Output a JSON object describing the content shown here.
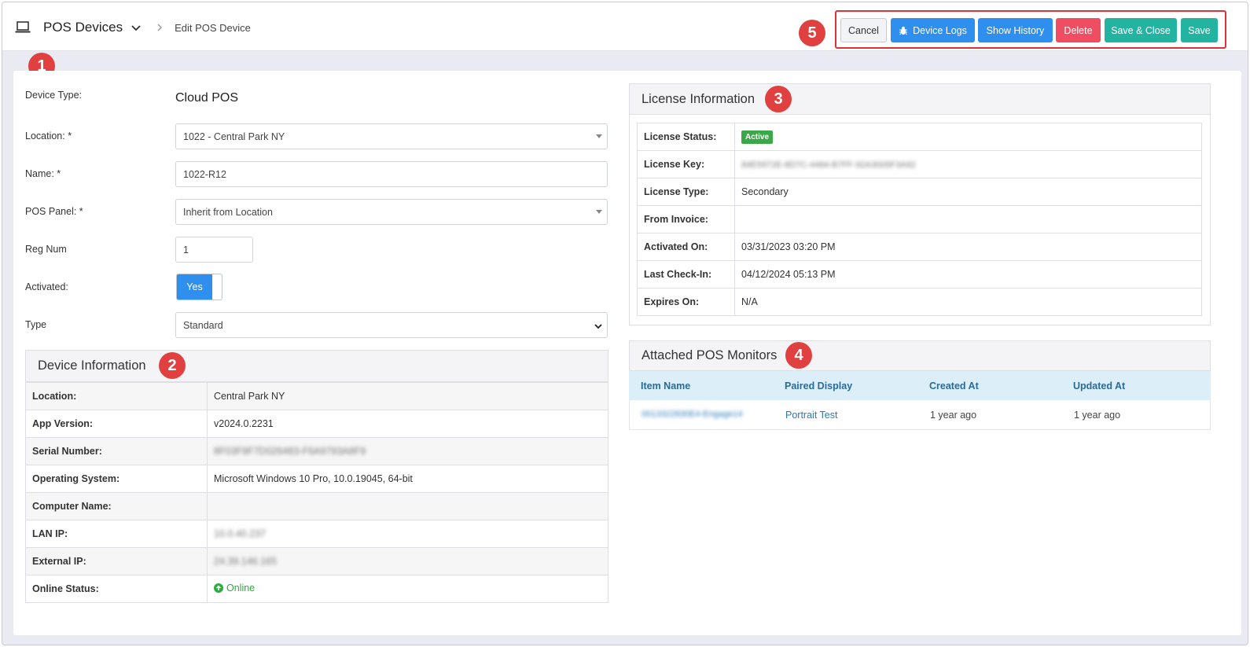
{
  "breadcrumb": {
    "module": "POS Devices",
    "current": "Edit POS Device",
    "icons": {
      "device": "laptop-icon",
      "dropdown": "chevron-down-icon",
      "separator": "chevron-right-icon"
    }
  },
  "toolbar": {
    "cancel": "Cancel",
    "device_logs": "Device Logs",
    "device_logs_icon": "bug-icon",
    "show_history": "Show History",
    "delete": "Delete",
    "save_close": "Save & Close",
    "save": "Save"
  },
  "callouts": [
    "1",
    "2",
    "3",
    "4",
    "5"
  ],
  "form": {
    "device_type": {
      "label": "Device Type:",
      "value": "Cloud POS"
    },
    "location": {
      "label": "Location: *",
      "value": "1022 - Central Park NY"
    },
    "name": {
      "label": "Name: *",
      "value": "1022-R12"
    },
    "pos_panel": {
      "label": "POS Panel: *",
      "value": "Inherit from Location"
    },
    "reg_num": {
      "label": "Reg Num",
      "value": "1"
    },
    "activated": {
      "label": "Activated:",
      "value": "Yes",
      "on": true
    },
    "type": {
      "label": "Type",
      "value": "Standard"
    }
  },
  "device_info": {
    "title": "Device Information",
    "rows": [
      {
        "key": "Location:",
        "value": "Central Park NY",
        "blurred": false
      },
      {
        "key": "App Version:",
        "value": "v2024.0.2231",
        "blurred": false
      },
      {
        "key": "Serial Number:",
        "value": "8F03F9F7D026483-F6A9793A8F9",
        "blurred": true
      },
      {
        "key": "Operating System:",
        "value": "Microsoft Windows 10 Pro, 10.0.19045, 64-bit",
        "blurred": false
      },
      {
        "key": "Computer Name:",
        "value": "",
        "blurred": false
      },
      {
        "key": "LAN IP:",
        "value": "10.0.40.237",
        "blurred": true
      },
      {
        "key": "External IP:",
        "value": "24.39.146.165",
        "blurred": true
      },
      {
        "key": "Online Status:",
        "value": "Online",
        "blurred": false
      }
    ]
  },
  "license": {
    "title": "License Information",
    "rows": [
      {
        "key": "License Status:",
        "value": "Active"
      },
      {
        "key": "License Key:",
        "value": "84E5972E-8D7C-4484-B7FF-92A3005F3A92"
      },
      {
        "key": "License Type:",
        "value": "Secondary"
      },
      {
        "key": "From Invoice:",
        "value": ""
      },
      {
        "key": "Activated On:",
        "value": "03/31/2023 03:20 PM"
      },
      {
        "key": "Last Check-In:",
        "value": "04/12/2024 05:13 PM"
      },
      {
        "key": "Expires On:",
        "value": "N/A"
      }
    ],
    "status_color": "#3aa849"
  },
  "monitors": {
    "title": "Attached POS Monitors",
    "columns": [
      "Item Name",
      "Paired Display",
      "Created At",
      "Updated At"
    ],
    "rows": [
      {
        "item_name": "0013322830E4-Engage14",
        "paired_display": "Portrait Test",
        "created_at": "1 year ago",
        "updated_at": "1 year ago"
      }
    ]
  },
  "colors": {
    "primary": "#2f8fef",
    "danger": "#ef4d62",
    "success": "#23b4a1",
    "callout": "#e0403f",
    "online": "#2eab3e"
  }
}
